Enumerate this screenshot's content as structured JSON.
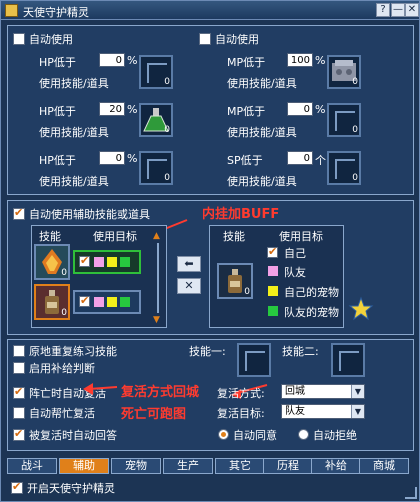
{
  "window": {
    "title": "天使守护精灵",
    "buttons": [
      "?",
      "—",
      "✕"
    ]
  },
  "top": {
    "hp_auto": "自动使用",
    "mp_auto": "自动使用",
    "rows": [
      {
        "label": "HP低于",
        "value": "0",
        "unit": "%",
        "use": "使用技能/道具"
      },
      {
        "label": "HP低于",
        "value": "20",
        "unit": "%",
        "use": "使用技能/道具"
      },
      {
        "label": "HP低于",
        "value": "0",
        "unit": "%",
        "use": "使用技能/道具"
      },
      {
        "label": "MP低于",
        "value": "100",
        "unit": "%",
        "use": "使用技能/道具"
      },
      {
        "label": "MP低于",
        "value": "0",
        "unit": "%",
        "use": "使用技能/道具"
      },
      {
        "label": "SP低于",
        "value": "0",
        "unit": "个",
        "use": "使用技能/道具"
      }
    ],
    "slot_counts": [
      "0",
      "0",
      "0",
      "0",
      "0",
      "0"
    ]
  },
  "buff": {
    "checkbox_label": "自动使用辅助技能或道具",
    "annotation": "内挂加BUFF",
    "col_skill": "技能",
    "col_target": "使用目标",
    "left_counts": [
      "0",
      "0"
    ],
    "right_col_skill": "技能",
    "right_col_target": "使用目标",
    "right_count": "0",
    "targets": [
      "自己",
      "队友",
      "自己的宠物",
      "队友的宠物"
    ],
    "arrow_left": "⬅",
    "cross": "✕"
  },
  "misc": {
    "reuse": "原地重复练习技能",
    "supply": "启用补给判断",
    "skill1": "技能一:",
    "skill2": "技能二:",
    "revive": "阵亡时自动复活",
    "revive_annotation": "复活方式回城",
    "revive_method_label": "复活方式:",
    "revive_method_value": "回城",
    "help_revive": "自动帮忙复活",
    "help_annotation": "死亡可跑图",
    "revive_target_label": "复活目标:",
    "revive_target_value": "队友",
    "when_revived": "被复活时自动回答",
    "agree": "自动同意",
    "refuse": "自动拒绝"
  },
  "tabs": [
    "战斗",
    "辅助",
    "宠物",
    "生产",
    "其它",
    "历程",
    "补给",
    "商城"
  ],
  "footer": "开启天使守护精灵",
  "colors": {
    "accent": "#e0801a",
    "annotation": "#ff3b2f"
  }
}
